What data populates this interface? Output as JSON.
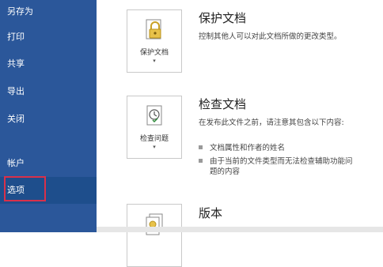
{
  "sidebar": {
    "items": [
      {
        "label": "另存为"
      },
      {
        "label": "打印"
      },
      {
        "label": "共享"
      },
      {
        "label": "导出"
      },
      {
        "label": "关闭"
      },
      {
        "label": "帐户"
      },
      {
        "label": "选项",
        "selected": true
      }
    ],
    "bg_color": "#2b579a",
    "highlight_color": "#d9304a"
  },
  "sections": [
    {
      "tile_label": "保护文档",
      "tile_icon": "lock-document-icon",
      "title": "保护文档",
      "description": "控制其他人可以对此文档所做的更改类型。"
    },
    {
      "tile_label": "检查问题",
      "tile_icon": "inspect-document-icon",
      "title": "检查文档",
      "description": "在发布此文件之前，请注意其包含以下内容:",
      "bullets": [
        "文档属性和作者的姓名",
        "由于当前的文件类型而无法检查辅助功能问题的内容"
      ]
    },
    {
      "tile_icon": "versions-icon",
      "title": "版本"
    }
  ],
  "tile_caret": "▾"
}
